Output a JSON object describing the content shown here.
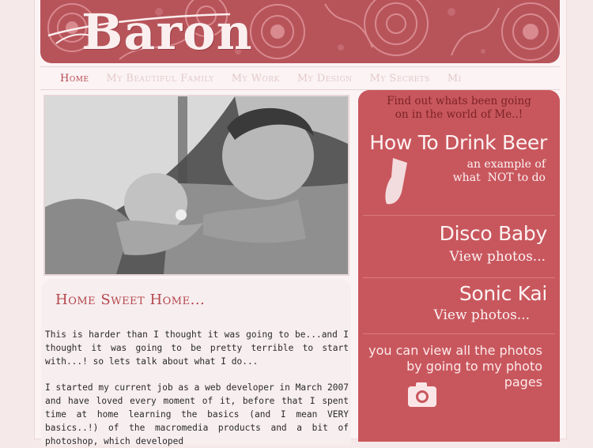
{
  "site": {
    "logo_text": "Baron"
  },
  "nav": {
    "items": [
      {
        "label": "Home",
        "active": true
      },
      {
        "label": "My Beautiful Family",
        "active": false
      },
      {
        "label": "My Work",
        "active": false
      },
      {
        "label": "My Design",
        "active": false
      },
      {
        "label": "My Secrets",
        "active": false
      },
      {
        "label": "Mi",
        "active": false
      }
    ]
  },
  "main": {
    "heading": "Home Sweet Home...",
    "paragraphs": [
      "This is harder than I thought it was going to be...and I thought it was going to be pretty terrible to start with...! so lets talk about what I do...",
      "I started my current job as a web developer in March 2007 and have loved every moment of it, before that I spent time at home learning the basics (and I mean VERY basics..!) of the macromedia products and a bit of photoshop, which developed"
    ]
  },
  "sidebar": {
    "intro": "Find out whats been going on in the world of Me..!",
    "features": [
      {
        "title": "How To Drink Beer",
        "subtitle_line1": "an example of",
        "subtitle_line2": "what  NOT to do",
        "icon": "beer-glass-icon"
      },
      {
        "title": "Disco Baby",
        "subtitle_line1": "View photos..."
      },
      {
        "title": "Sonic Kai",
        "subtitle_line1": "View photos..."
      }
    ],
    "photo_note": "you can view all the photos by going to my photo pages",
    "photo_icon": "camera-icon"
  },
  "colors": {
    "accent": "#b5474e",
    "sidebar_bg": "#c8575d",
    "banner_bg": "#b7545a",
    "page_bg": "#f6e9ea"
  }
}
